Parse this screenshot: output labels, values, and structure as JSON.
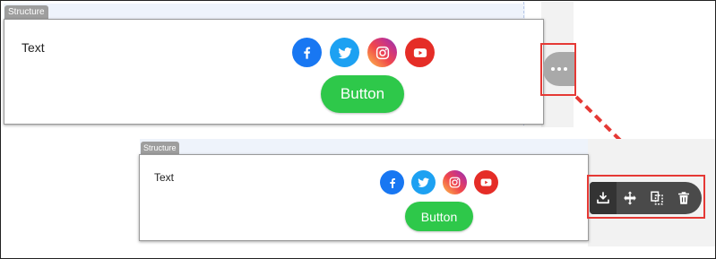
{
  "top_block": {
    "tab_label": "Structure",
    "text": "Text",
    "button_label": "Button"
  },
  "bottom_block": {
    "tab_label": "Structure",
    "text": "Text",
    "button_label": "Button"
  },
  "social_icons": [
    "facebook-icon",
    "twitter-icon",
    "instagram-icon",
    "youtube-icon"
  ],
  "more_button": {
    "icon": "more-dots-icon"
  },
  "toolbar": {
    "tools": [
      "save-icon",
      "move-icon",
      "duplicate-icon",
      "delete-icon"
    ]
  },
  "colors": {
    "accent_red": "#e53935",
    "button_green": "#2ec84a",
    "facebook": "#1877f2",
    "twitter": "#1da1f2",
    "youtube": "#e52d27",
    "toolbar_bg": "#4a4a4a"
  }
}
